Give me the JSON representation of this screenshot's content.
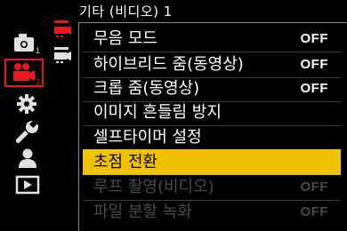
{
  "menu": {
    "title": "기타 (비디오) 1",
    "items": [
      {
        "label": "무음 모드",
        "value": "OFF",
        "state": "normal"
      },
      {
        "label": "하이브리드 줌(동영상)",
        "value": "OFF",
        "state": "normal"
      },
      {
        "label": "크롭 줌(동영상)",
        "value": "OFF",
        "state": "normal"
      },
      {
        "label": "이미지 흔들림 방지",
        "value": "",
        "state": "normal"
      },
      {
        "label": "셀프타이머 설정",
        "value": "",
        "state": "normal"
      },
      {
        "label": "초점 전환",
        "value": "",
        "state": "selected"
      },
      {
        "label": "루프 촬영(비디오)",
        "value": "OFF",
        "state": "disabled"
      },
      {
        "label": "파일 분할 녹화",
        "value": "OFF",
        "state": "disabled"
      }
    ]
  },
  "sidebar": {
    "tabs": [
      {
        "icon": "photo-camera-icon",
        "sub": "1"
      },
      {
        "icon": "video-camera-icon",
        "sub": "2",
        "selected": true
      },
      {
        "icon": "gear-icon"
      },
      {
        "icon": "wrench-icon"
      },
      {
        "icon": "person-icon"
      },
      {
        "icon": "playback-icon"
      }
    ],
    "page_indicators": [
      {
        "icon": "page-1-selected-icon"
      },
      {
        "icon": "page-2-icon"
      }
    ]
  },
  "colors": {
    "accent": "#f2c200",
    "selected_tab": "#e8181c",
    "disabled_text": "#4a4a4a"
  }
}
